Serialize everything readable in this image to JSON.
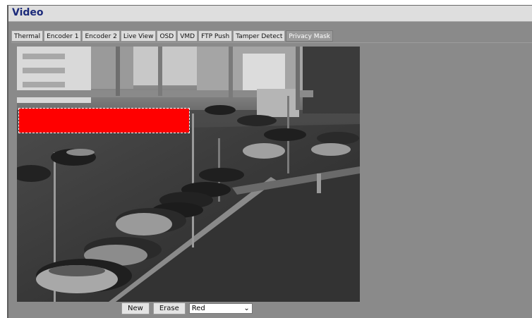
{
  "section": {
    "title": "Video"
  },
  "tabs": [
    {
      "label": "Thermal",
      "active": false
    },
    {
      "label": "Encoder 1",
      "active": false
    },
    {
      "label": "Encoder 2",
      "active": false
    },
    {
      "label": "Live View",
      "active": false
    },
    {
      "label": "OSD",
      "active": false
    },
    {
      "label": "VMD",
      "active": false
    },
    {
      "label": "FTP Push",
      "active": false
    },
    {
      "label": "Tamper Detect",
      "active": false
    },
    {
      "label": "Privacy Mask",
      "active": true
    }
  ],
  "privacy_mask": {
    "mask_color_hex": "#ff0000",
    "new_button_label": "New",
    "erase_button_label": "Erase",
    "color_select": {
      "value": "Red"
    }
  },
  "colors": {
    "header_title": "#1b2a7a",
    "panel_background": "#8a8a8a",
    "active_tab": "#9a9a9a"
  }
}
